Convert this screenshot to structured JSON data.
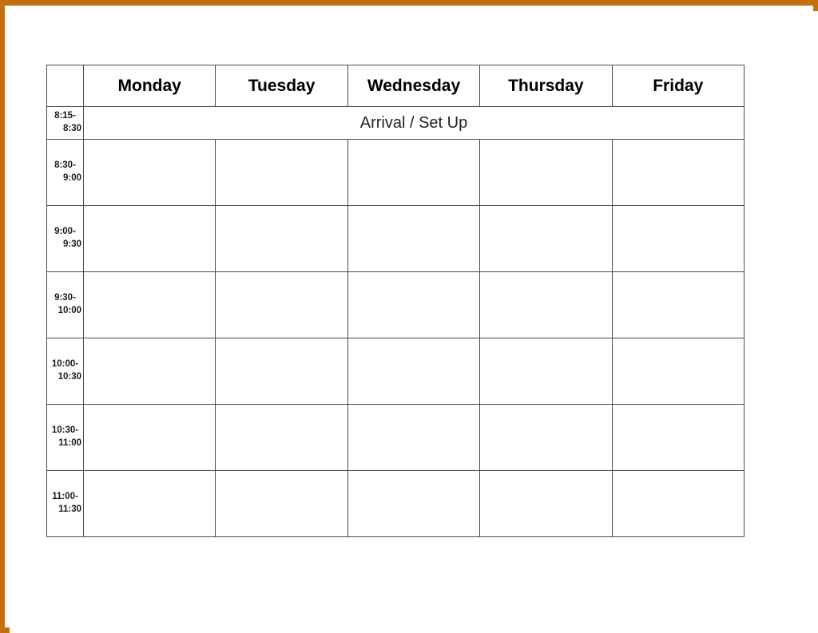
{
  "page": {
    "frame_color": "#c4700f",
    "background_color": "#ffffff"
  },
  "schedule": {
    "corner_label": "",
    "day_headers": [
      "Monday",
      "Tuesday",
      "Wednesday",
      "Thursday",
      "Friday"
    ],
    "arrival_row": {
      "time_start": "8:15-",
      "time_end": "8:30",
      "label": "Arrival / Set Up"
    },
    "rows": [
      {
        "time_start": "8:30-",
        "time_end": "9:00"
      },
      {
        "time_start": "9:00-",
        "time_end": "9:30"
      },
      {
        "time_start": "9:30-",
        "time_end": "10:00"
      },
      {
        "time_start": "10:00-",
        "time_end": "10:30"
      },
      {
        "time_start": "10:30-",
        "time_end": "11:00"
      },
      {
        "time_start": "11:00-",
        "time_end": "11:30"
      }
    ],
    "empty_cell_text": ""
  }
}
